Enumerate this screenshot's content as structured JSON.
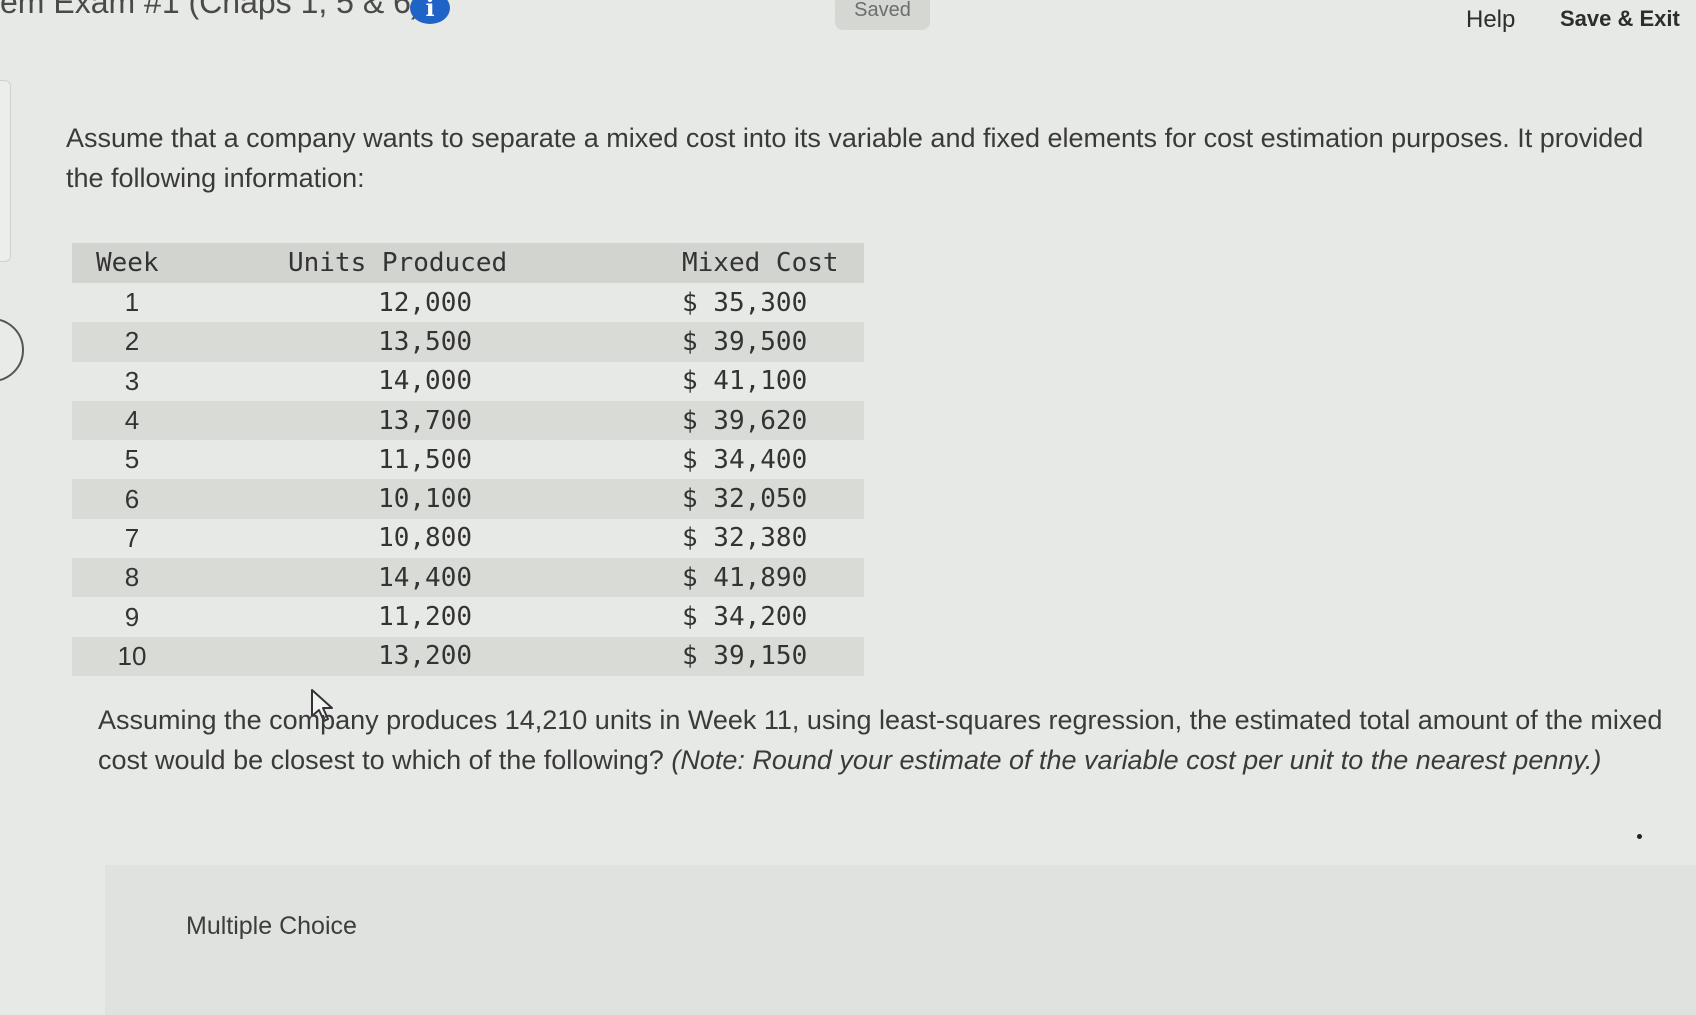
{
  "header": {
    "exam_title": "em Exam #1 (Chaps 1, 5 & 6)",
    "info_icon_glyph": "i",
    "saved_status": "Saved",
    "help_label": "Help",
    "save_exit_label": "Save & Exit"
  },
  "question": {
    "intro": "Assume that a company wants to separate a mixed cost into its variable and fixed elements for cost estimation purposes. It provided the following information:",
    "table": {
      "headers": [
        "Week",
        "Units Produced",
        "Mixed Cost"
      ],
      "rows": [
        [
          "1",
          "12,000",
          "$ 35,300"
        ],
        [
          "2",
          "13,500",
          "$ 39,500"
        ],
        [
          "3",
          "14,000",
          "$ 41,100"
        ],
        [
          "4",
          "13,700",
          "$ 39,620"
        ],
        [
          "5",
          "11,500",
          "$ 34,400"
        ],
        [
          "6",
          "10,100",
          "$ 32,050"
        ],
        [
          "7",
          "10,800",
          "$ 32,380"
        ],
        [
          "8",
          "14,400",
          "$ 41,890"
        ],
        [
          "9",
          "11,200",
          "$ 34,200"
        ],
        [
          "10",
          "13,200",
          "$ 39,150"
        ]
      ]
    },
    "prompt": "Assuming the company produces 14,210 units in Week 11, using least-squares regression, the estimated total amount of the mixed cost would be closest to which of the following?",
    "note": "(Note: Round your estimate of the variable cost per unit to the nearest penny.)"
  },
  "answer_section": {
    "label": "Multiple Choice"
  },
  "colors": {
    "info_icon": "#1f63c6",
    "table_header_bg": "#d2d4d0",
    "page_bg": "#e7e9e6"
  }
}
